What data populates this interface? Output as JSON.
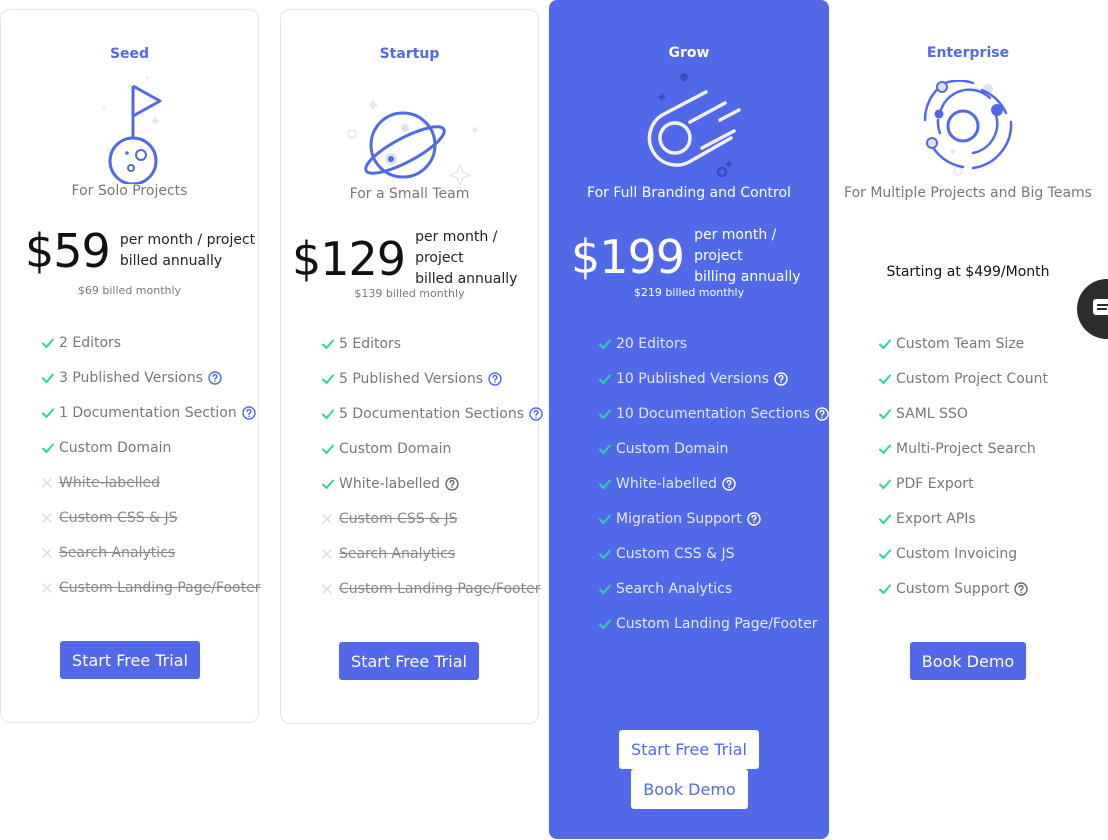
{
  "colors": {
    "accent": "#5169e8",
    "check": "#2ed3a0",
    "cross": "#d7d9ec",
    "text_muted": "#777777"
  },
  "plans": [
    {
      "name": "Seed",
      "icon": "flag-planet-icon",
      "subtitle": "For Solo Projects",
      "price": "$59",
      "price_note_1": "per month / project",
      "price_note_2": "billed annually",
      "monthly": "$69 billed monthly",
      "features": [
        {
          "label": "2 Editors",
          "included": true,
          "help": false
        },
        {
          "label": "3 Published Versions",
          "included": true,
          "help": true
        },
        {
          "label": "1 Documentation Section",
          "included": true,
          "help": true
        },
        {
          "label": "Custom Domain",
          "included": true,
          "help": false
        },
        {
          "label": "White-labelled",
          "included": false,
          "help": false
        },
        {
          "label": "Custom CSS & JS",
          "included": false,
          "help": false
        },
        {
          "label": "Search Analytics",
          "included": false,
          "help": false
        },
        {
          "label": "Custom Landing Page/Footer",
          "included": false,
          "help": false
        }
      ],
      "buttons": [
        "Start Free Trial"
      ]
    },
    {
      "name": "Startup",
      "icon": "planet-ring-icon",
      "subtitle": "For a Small Team",
      "price": "$129",
      "price_note_1": "per month / project",
      "price_note_2": "billed annually",
      "monthly": "$139 billed monthly",
      "features": [
        {
          "label": "5 Editors",
          "included": true,
          "help": false
        },
        {
          "label": "5 Published Versions",
          "included": true,
          "help": true
        },
        {
          "label": "5 Documentation Sections",
          "included": true,
          "help": true
        },
        {
          "label": "Custom Domain",
          "included": true,
          "help": false
        },
        {
          "label": "White-labelled",
          "included": true,
          "help": true
        },
        {
          "label": "Custom CSS & JS",
          "included": false,
          "help": false
        },
        {
          "label": "Search Analytics",
          "included": false,
          "help": false
        },
        {
          "label": "Custom Landing Page/Footer",
          "included": false,
          "help": false
        }
      ],
      "buttons": [
        "Start Free Trial"
      ]
    },
    {
      "name": "Grow",
      "icon": "comet-icon",
      "subtitle": "For Full Branding and Control",
      "price": "$199",
      "price_note_1": "per month / project",
      "price_note_2": "billing annually",
      "monthly": "$219 billed monthly",
      "features": [
        {
          "label": "20 Editors",
          "included": true,
          "help": false
        },
        {
          "label": "10 Published Versions",
          "included": true,
          "help": true
        },
        {
          "label": "10 Documentation Sections",
          "included": true,
          "help": true
        },
        {
          "label": "Custom Domain",
          "included": true,
          "help": false
        },
        {
          "label": "White-labelled",
          "included": true,
          "help": true
        },
        {
          "label": "Migration Support",
          "included": true,
          "help": true
        },
        {
          "label": "Custom CSS & JS",
          "included": true,
          "help": false
        },
        {
          "label": "Search Analytics",
          "included": true,
          "help": false
        },
        {
          "label": "Custom Landing Page/Footer",
          "included": true,
          "help": false
        }
      ],
      "buttons": [
        "Start Free Trial",
        "Book Demo"
      ]
    },
    {
      "name": "Enterprise",
      "icon": "solar-system-icon",
      "subtitle": "For Multiple Projects and Big Teams",
      "starting": "Starting at $499/Month",
      "features": [
        {
          "label": "Custom Team Size",
          "included": true,
          "help": false
        },
        {
          "label": "Custom Project Count",
          "included": true,
          "help": false
        },
        {
          "label": "SAML SSO",
          "included": true,
          "help": false
        },
        {
          "label": "Multi-Project Search",
          "included": true,
          "help": false
        },
        {
          "label": "PDF Export",
          "included": true,
          "help": false
        },
        {
          "label": "Export APIs",
          "included": true,
          "help": false
        },
        {
          "label": "Custom Invoicing",
          "included": true,
          "help": false
        },
        {
          "label": "Custom Support",
          "included": true,
          "help": true
        }
      ],
      "buttons": [
        "Book Demo"
      ]
    }
  ],
  "chat_widget": {
    "icon": "chat-icon"
  }
}
